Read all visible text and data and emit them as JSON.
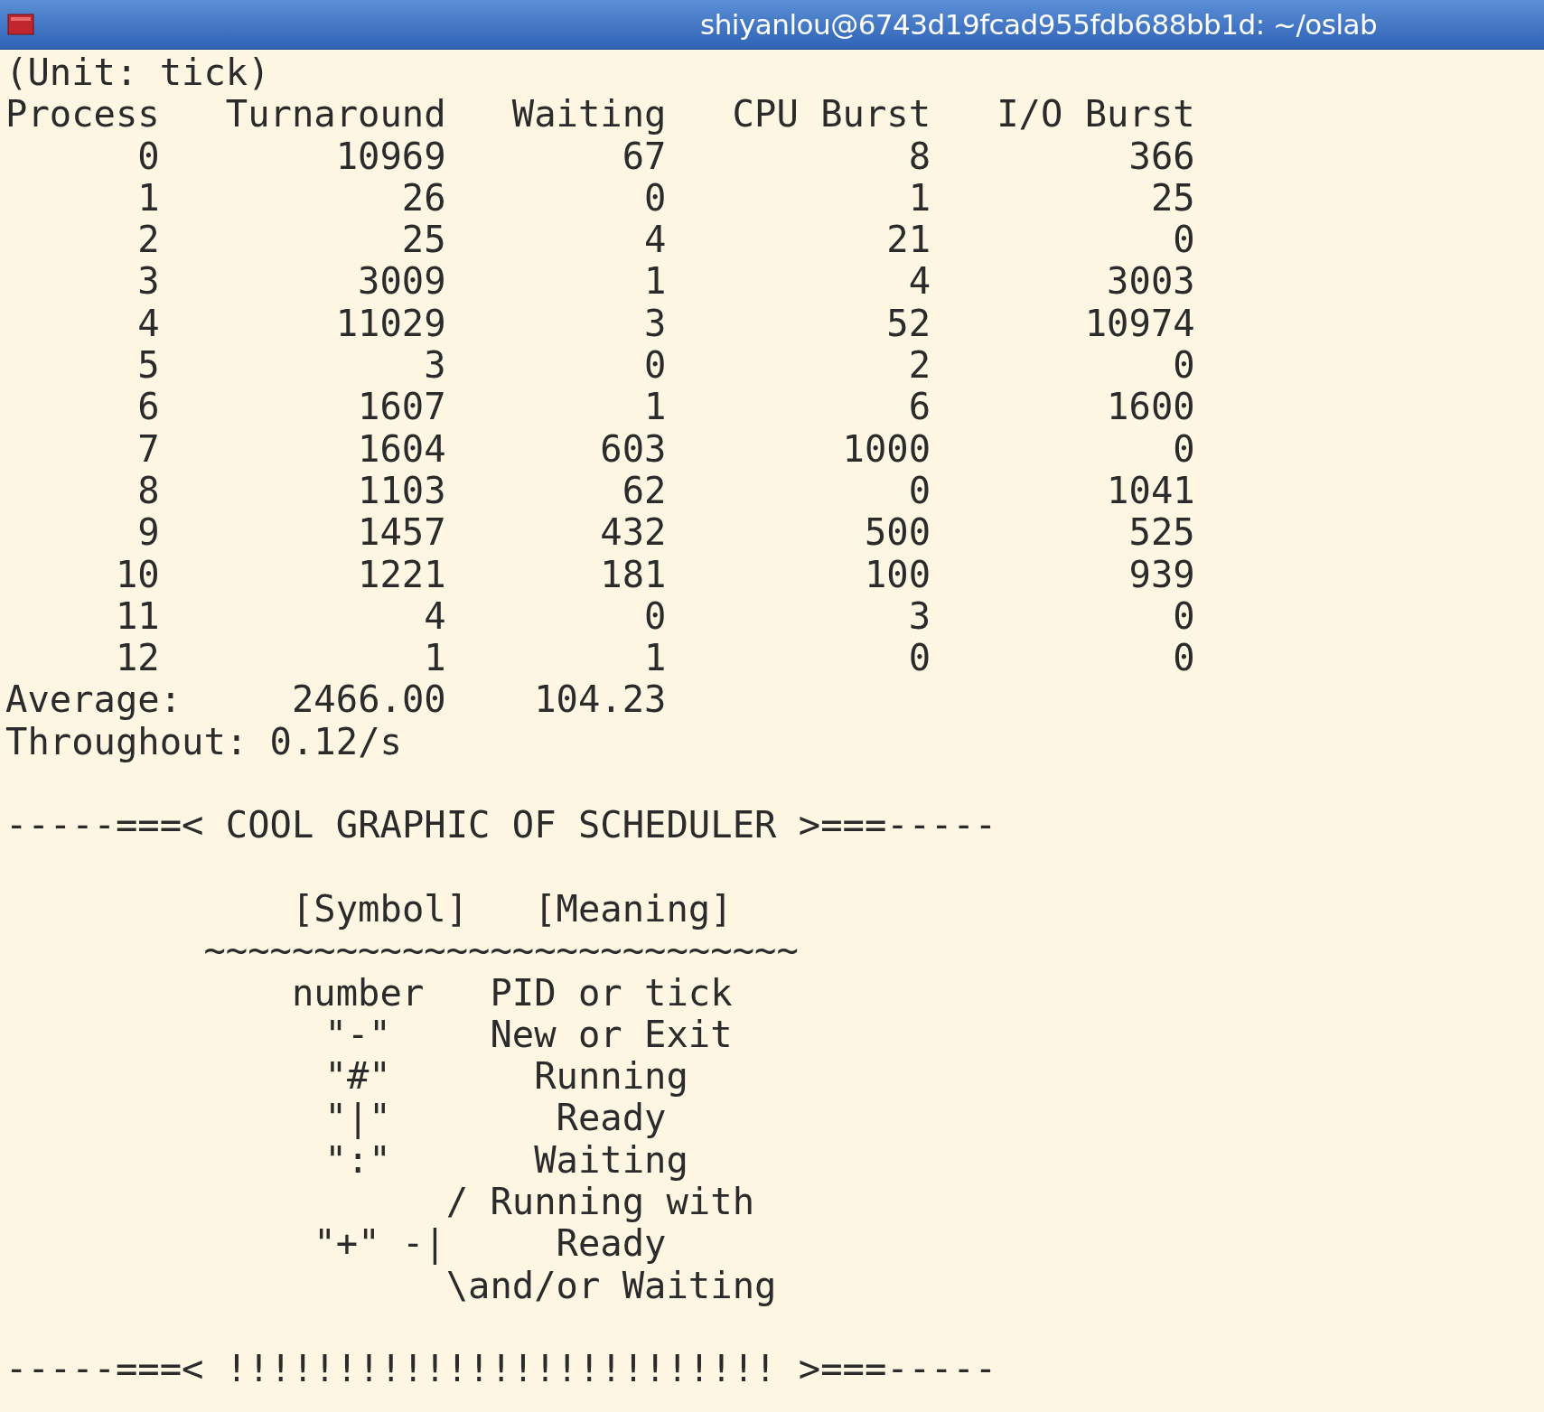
{
  "window": {
    "title": "shiyanlou@6743d19fcad955fdb688bb1d: ~/oslab"
  },
  "unit_line": "(Unit: tick)",
  "table": {
    "columns": [
      "Process",
      "Turnaround",
      "Waiting",
      "CPU Burst",
      "I/O Burst"
    ],
    "rows": [
      [
        "0",
        "10969",
        "67",
        "8",
        "366"
      ],
      [
        "1",
        "26",
        "0",
        "1",
        "25"
      ],
      [
        "2",
        "25",
        "4",
        "21",
        "0"
      ],
      [
        "3",
        "3009",
        "1",
        "4",
        "3003"
      ],
      [
        "4",
        "11029",
        "3",
        "52",
        "10974"
      ],
      [
        "5",
        "3",
        "0",
        "2",
        "0"
      ],
      [
        "6",
        "1607",
        "1",
        "6",
        "1600"
      ],
      [
        "7",
        "1604",
        "603",
        "1000",
        "0"
      ],
      [
        "8",
        "1103",
        "62",
        "0",
        "1041"
      ],
      [
        "9",
        "1457",
        "432",
        "500",
        "525"
      ],
      [
        "10",
        "1221",
        "181",
        "100",
        "939"
      ],
      [
        "11",
        "4",
        "0",
        "3",
        "0"
      ],
      [
        "12",
        "1",
        "1",
        "0",
        "0"
      ]
    ],
    "average": {
      "label": "Average:",
      "values": [
        "2466.00",
        "104.23"
      ]
    }
  },
  "throughput_line": "Throughout: 0.12/s",
  "banner_top": "-----===< COOL GRAPHIC OF SCHEDULER >===-----",
  "legend": {
    "headers": [
      "[Symbol]",
      "[Meaning]"
    ],
    "rule": "~~~~~~~~~~~~~~~~~~~~~~~~~~~",
    "entries": [
      {
        "kind": "single",
        "symbol": "number",
        "meaning": "PID or tick"
      },
      {
        "kind": "single",
        "symbol": "\"-\"",
        "meaning": "New or Exit"
      },
      {
        "kind": "single",
        "symbol": "\"#\"",
        "meaning": "Running"
      },
      {
        "kind": "single",
        "symbol": "\"|\"",
        "meaning": "Ready"
      },
      {
        "kind": "single",
        "symbol": "\":\"",
        "meaning": "Waiting"
      },
      {
        "kind": "compound",
        "top": "/ Running with",
        "symbol": "\"+\"",
        "brace": "-|",
        "middle": "Ready",
        "bottom": "\\and/or Waiting"
      }
    ]
  },
  "banner_bottom": "-----===< !!!!!!!!!!!!!!!!!!!!!!!!! >===-----"
}
